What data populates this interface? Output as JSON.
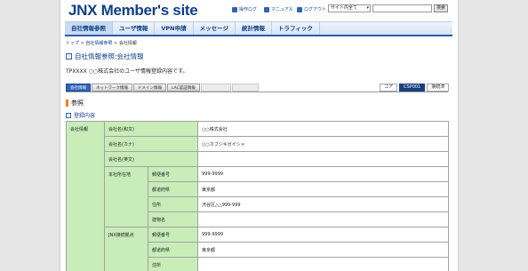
{
  "header": {
    "logo": "JNX Member's site",
    "links": [
      {
        "label": "操作ログ",
        "icon": "log-icon"
      },
      {
        "label": "マニュアル",
        "icon": "manual-icon"
      },
      {
        "label": "ログアウト",
        "icon": "logout-icon"
      }
    ],
    "search": {
      "select_value": "サイト内全て",
      "button": "検索"
    }
  },
  "nav": {
    "items": [
      "自社情報参照",
      "ユーザ情報",
      "VPN申請",
      "メッセージ",
      "統計情報",
      "トラフィック"
    ],
    "active_index": 0
  },
  "breadcrumb": {
    "home": "トップ",
    "sep": ">",
    "parent": "自社情報参照",
    "current": "会社情報"
  },
  "page": {
    "title": "自社情報参照:会社情報",
    "description": "TPXXXX ○○株式会社のユーザ情報登録内容です。"
  },
  "tabs": [
    {
      "label": "会社情報",
      "state": "active"
    },
    {
      "label": "ネットワーク情報",
      "state": "normal"
    },
    {
      "label": "ドメイン情報",
      "state": "normal"
    },
    {
      "label": "LAC認証情報",
      "state": "normal"
    },
    {
      "label": "",
      "state": "disabled"
    },
    {
      "label": "",
      "state": "disabled"
    }
  ],
  "right_tabs": [
    {
      "label": "コア",
      "active": false
    },
    {
      "label": "CSP001",
      "active": true
    },
    {
      "label": "接続済",
      "active": false
    }
  ],
  "section": {
    "title": "参照",
    "subtitle": "登録内容"
  },
  "table": {
    "group": "会社情報",
    "company_name_label": "会社名(和文)",
    "company_name_value": "○○株式会社",
    "company_kana_label": "会社名(カナ)",
    "company_kana_value": "○○カブシキガイシャ",
    "company_en_label": "会社名(英文)",
    "company_en_value": "",
    "hq_label": "本社所在地",
    "jnx_label": "JNX接続拠点",
    "postal_label": "郵便番号",
    "pref_label": "都道府県",
    "address_label": "住所",
    "building_label": "建物名",
    "hq_postal": "999-9999",
    "hq_pref": "東京都",
    "hq_address": "渋谷区△△999-999",
    "hq_building": "",
    "jnx_postal": "999-9999",
    "jnx_pref": "東京都",
    "jnx_address": ""
  },
  "colors": {
    "brand": "#0f3f86",
    "accent": "#ef7d1f",
    "label_bg": "#c8edb9"
  }
}
